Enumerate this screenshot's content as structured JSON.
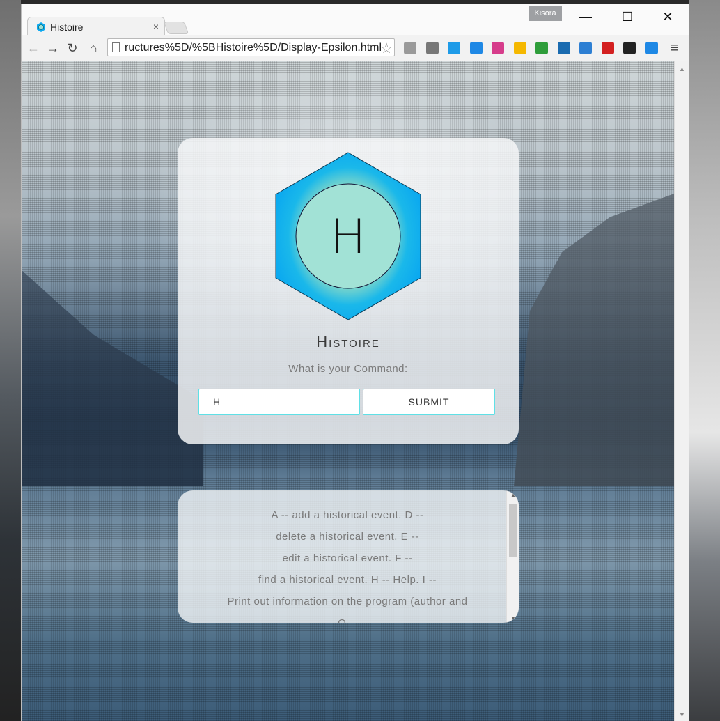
{
  "browser": {
    "tab_title": "Histoire",
    "tab_close": "×",
    "profile_name": "Kisora",
    "url": "ructures%5D/%5BHistoire%5D/Display-Epsilon.html",
    "window_controls": {
      "minimize": "—",
      "maximize": "☐",
      "close": "✕"
    },
    "nav": {
      "back": "←",
      "forward": "→",
      "reload": "↻",
      "home": "⌂"
    },
    "star": "☆",
    "menu": "≡",
    "extensions": [
      {
        "name": "power-extension-icon",
        "color": "#9a9a9a"
      },
      {
        "name": "film-extension-icon",
        "color": "#777777"
      },
      {
        "name": "code-extension-icon",
        "color": "#1e9be8"
      },
      {
        "name": "back-arrow-extension-icon",
        "color": "#1e88e5"
      },
      {
        "name": "tag-extension-icon",
        "color": "#d63c8b"
      },
      {
        "name": "calendar-extension-icon",
        "color": "#f5b800"
      },
      {
        "name": "diamond-extension-icon",
        "color": "#2e9d3a"
      },
      {
        "name": "eye-extension-icon",
        "color": "#1a6bb0"
      },
      {
        "name": "window-extension-icon",
        "color": "#2d7fd3"
      },
      {
        "name": "adblock-extension-icon",
        "color": "#d32020"
      },
      {
        "name": "badge-extension-icon",
        "color": "#222222"
      },
      {
        "name": "sync-extension-icon",
        "color": "#1e88e5"
      }
    ]
  },
  "app": {
    "logo_letter": "H",
    "title": "Histoire",
    "prompt": "What is your Command:",
    "command_value": "H",
    "submit_label": "SUBMIT",
    "accent_color": "#5fe0e6",
    "hexagon_color": "#0aa8f0",
    "circle_color": "#9fe0d6"
  },
  "help": {
    "text": "A -- add a historical event. D --\ndelete a historical event. E --\nedit a historical event. F --\nfind a historical event. H -- Help. I --\nPrint out information on the program (author and\nQ --"
  }
}
